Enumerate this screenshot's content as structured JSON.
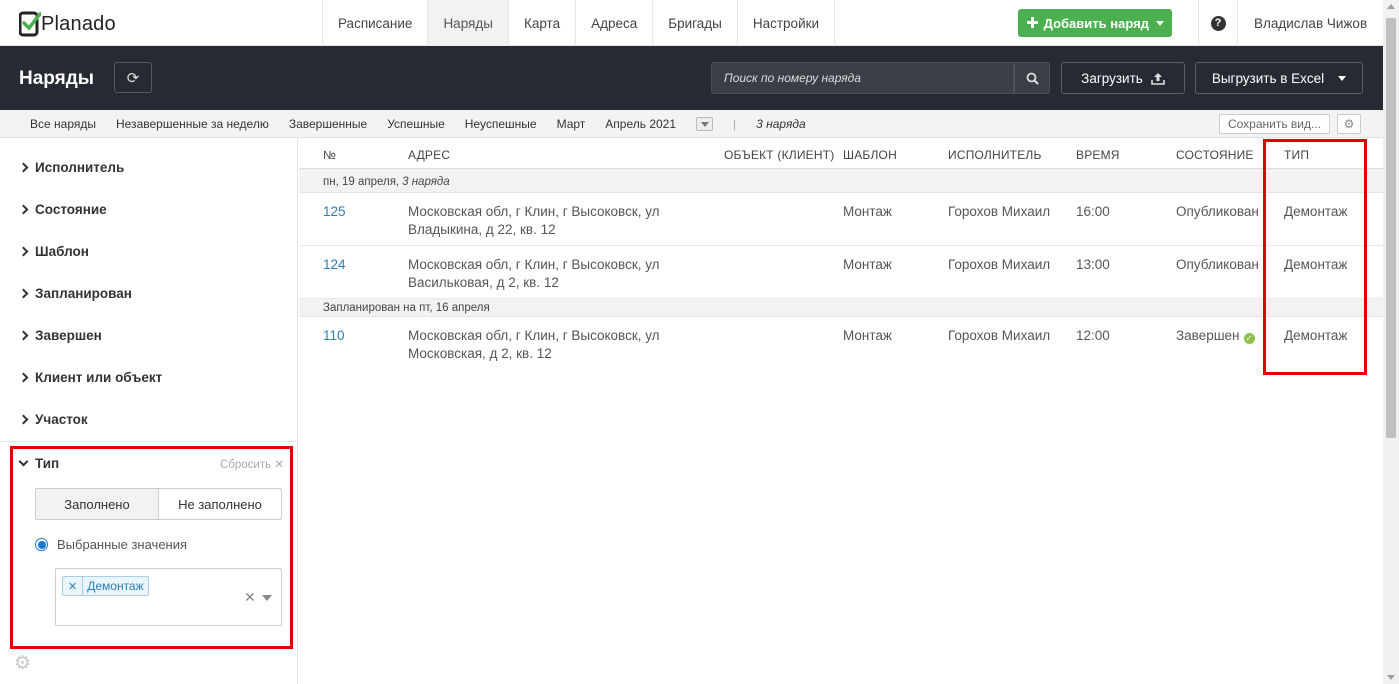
{
  "app": {
    "name": "Planado"
  },
  "nav": {
    "tabs": [
      {
        "label": "Расписание"
      },
      {
        "label": "Наряды"
      },
      {
        "label": "Карта"
      },
      {
        "label": "Адреса"
      },
      {
        "label": "Бригады"
      },
      {
        "label": "Настройки"
      }
    ],
    "active_tab": "Наряды",
    "add_button": "Добавить наряд",
    "user_name": "Владислав Чижов"
  },
  "header": {
    "title": "Наряды",
    "search_placeholder": "Поиск по номеру наряда",
    "upload_label": "Загрузить",
    "export_label": "Выгрузить в Excel"
  },
  "filters": {
    "tabs": [
      "Все наряды",
      "Незавершенные за неделю",
      "Завершенные",
      "Успешные",
      "Неуспешные",
      "Март",
      "Апрель 2021"
    ],
    "count": "3 наряда",
    "save_view": "Сохранить вид..."
  },
  "sidebar": {
    "items": [
      "Исполнитель",
      "Состояние",
      "Шаблон",
      "Запланирован",
      "Завершен",
      "Клиент или объект",
      "Участок"
    ],
    "expanded": {
      "title": "Тип",
      "reset_label": "Сбросить",
      "segment": [
        "Заполнено",
        "Не заполнено"
      ],
      "radio_label": "Выбранные значения",
      "selected_tags": [
        "Демонтаж"
      ]
    }
  },
  "table": {
    "columns": [
      "№",
      "АДРЕС",
      "ОБЪЕКТ (КЛИЕНТ)",
      "ШАБЛОН",
      "ИСПОЛНИТЕЛЬ",
      "ВРЕМЯ",
      "СОСТОЯНИЕ",
      "ТИП"
    ],
    "groups": [
      {
        "label": "пн, 19 апреля,",
        "note": "3 наряда"
      },
      {
        "label": "Запланирован на пт, 16 апреля",
        "note": ""
      }
    ],
    "rows": [
      {
        "num": "125",
        "address1": "Московская обл, г Клин, г Высоковск, ул",
        "address2": "Владыкина, д 22, кв. 12",
        "object": "",
        "template": "Монтаж",
        "assignee": "Горохов Михаил",
        "time": "16:00",
        "status": "Опубликован",
        "type": "Демонтаж"
      },
      {
        "num": "124",
        "address1": "Московская обл, г Клин, г Высоковск, ул",
        "address2": "Васильковая, д 2, кв. 12",
        "object": "",
        "template": "Монтаж",
        "assignee": "Горохов Михаил",
        "time": "13:00",
        "status": "Опубликован",
        "type": "Демонтаж"
      },
      {
        "num": "110",
        "address1": "Московская обл, г Клин, г Высоковск, ул",
        "address2": "Московская, д 2, кв. 12",
        "object": "",
        "template": "Монтаж",
        "assignee": "Горохов Михаил",
        "time": "12:00",
        "status": "Завершен",
        "type": "Демонтаж"
      }
    ]
  },
  "colors": {
    "accent": "#4caf50",
    "link": "#2a7fb8",
    "dark_header": "#262a33",
    "highlight": "#e00000"
  }
}
